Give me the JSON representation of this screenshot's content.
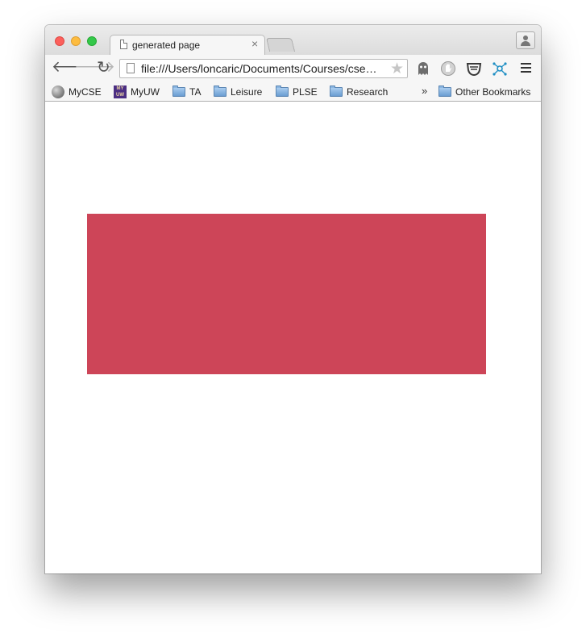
{
  "tab": {
    "title": "generated page",
    "close_glyph": "×"
  },
  "toolbar": {
    "back_glyph": "🡐",
    "forward_glyph": "🡒",
    "reload_glyph": "↻",
    "url": "file:///Users/loncaric/Documents/Courses/cse…",
    "star_glyph": "★"
  },
  "extensions": [
    "ghost-icon",
    "shield-icon",
    "mask-icon",
    "network-icon"
  ],
  "bookmarks": {
    "items": [
      {
        "label": "MyCSE",
        "icon": "mycse-icon"
      },
      {
        "label": "MyUW",
        "icon": "myuw-icon"
      },
      {
        "label": "TA",
        "icon": "folder-icon"
      },
      {
        "label": "Leisure",
        "icon": "folder-icon"
      },
      {
        "label": "PLSE",
        "icon": "folder-icon"
      },
      {
        "label": "Research",
        "icon": "folder-icon"
      }
    ],
    "more_glyph": "»",
    "other": "Other Bookmarks"
  },
  "page": {
    "box_color": "#cd4558"
  },
  "colors": {
    "close": "#fc605c",
    "minimize": "#fdbc40",
    "zoom": "#34c84a"
  }
}
